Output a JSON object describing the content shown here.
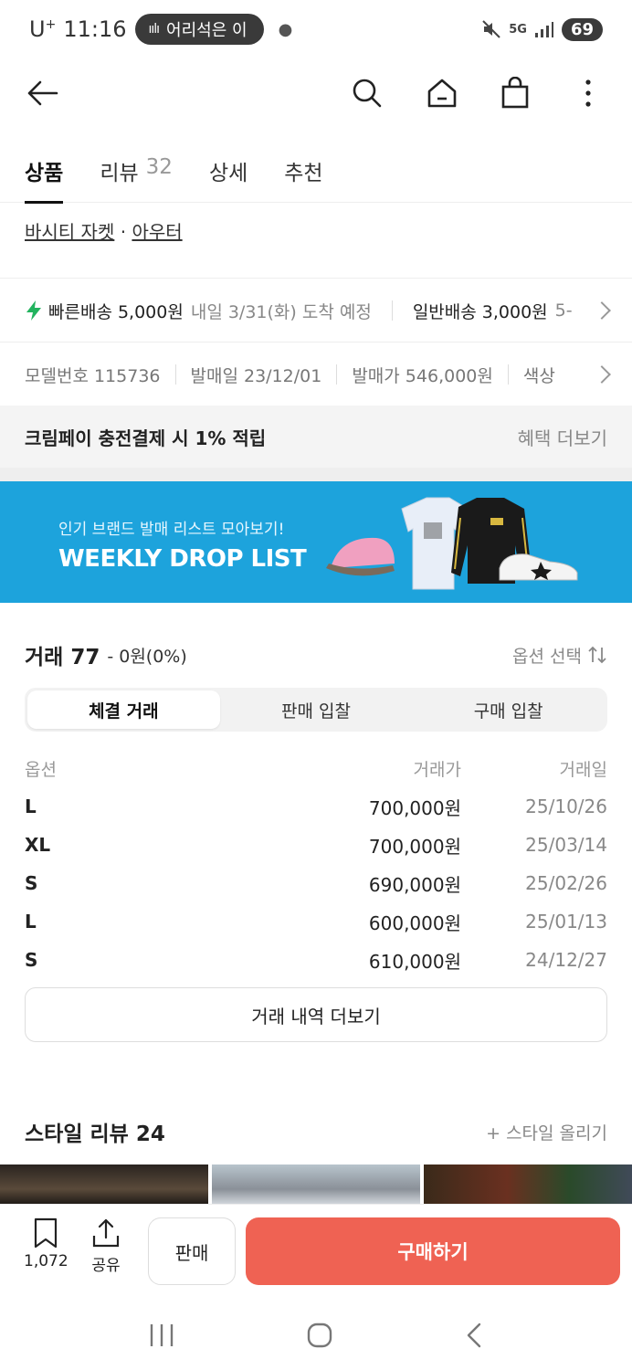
{
  "status_bar": {
    "carrier": "U",
    "carrier_sup": "+",
    "time": "11:16",
    "pill_text": "어리석은 이",
    "network": "5G",
    "battery": "69"
  },
  "tabs": [
    {
      "label": "상품",
      "count": ""
    },
    {
      "label": "리뷰",
      "count": "32"
    },
    {
      "label": "상세",
      "count": ""
    },
    {
      "label": "추천",
      "count": ""
    }
  ],
  "category": {
    "primary": "바시티 자켓",
    "separator": "·",
    "secondary": "아우터"
  },
  "delivery": {
    "fast_label": "빠른배송 5,000원",
    "fast_eta": "내일 3/31(화) 도착 예정",
    "normal_label": "일반배송 3,000원",
    "normal_eta": "5-"
  },
  "product_info": {
    "model": "모델번호 115736",
    "release": "발매일 23/12/01",
    "price": "발매가 546,000원",
    "color": "색상"
  },
  "benefit": {
    "title": "크림페이 충전결제 시 1% 적립",
    "more": "혜택 더보기"
  },
  "banner": {
    "subtitle": "인기 브랜드 발매 리스트 모아보기!",
    "title": "WEEKLY DROP LIST",
    "bg_color": "#1da3dc"
  },
  "trade": {
    "title": "거래 77",
    "change": "- 0원(0%)",
    "option_select": "옵션 선택",
    "segments": [
      "체결 거래",
      "판매 입찰",
      "구매 입찰"
    ],
    "columns": [
      "옵션",
      "거래가",
      "거래일"
    ],
    "rows": [
      {
        "option": "L",
        "price": "700,000원",
        "date": "25/10/26"
      },
      {
        "option": "XL",
        "price": "700,000원",
        "date": "25/03/14"
      },
      {
        "option": "S",
        "price": "690,000원",
        "date": "25/02/26"
      },
      {
        "option": "L",
        "price": "600,000원",
        "date": "25/01/13"
      },
      {
        "option": "S",
        "price": "610,000원",
        "date": "24/12/27"
      }
    ],
    "more_button": "거래 내역 더보기"
  },
  "style_review": {
    "title": "스타일 리뷰 24",
    "upload": "+ 스타일 올리기"
  },
  "bottom_bar": {
    "bookmark_count": "1,072",
    "share_label": "공유",
    "sell_label": "판매",
    "buy_label": "구매하기",
    "buy_color": "#ef6253"
  }
}
